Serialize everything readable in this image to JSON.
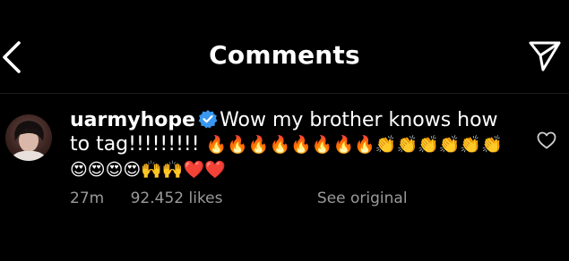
{
  "header": {
    "title": "Comments"
  },
  "comment": {
    "username": "uarmyhope",
    "text": "Wow my brother knows how to tag!!!!!!!!! ",
    "emojis": "🔥🔥🔥🔥🔥🔥🔥🔥👏👏👏👏👏👏😍😍😍😍🙌🙌❤️❤️",
    "time": "27m",
    "likes": "92.452 likes",
    "see_original": "See original"
  },
  "icons": {
    "back": "chevron-left-icon",
    "send": "paper-plane-icon",
    "verified": "verified-badge-icon",
    "like": "heart-outline-icon"
  },
  "colors": {
    "background": "#000000",
    "text": "#ffffff",
    "muted": "#9a9a9a",
    "verified": "#3897f0"
  }
}
